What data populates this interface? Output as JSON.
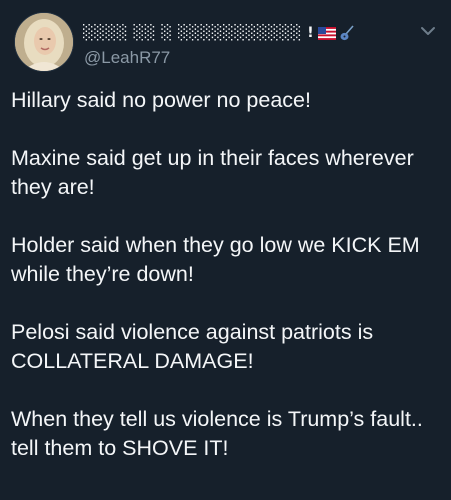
{
  "tweet": {
    "display_name": "░░░░ ░░ ░ ░░░░░░░░░░░ !",
    "handle": "@LeahR77",
    "badges": [
      "us-flag-icon",
      "guitar-icon"
    ],
    "paragraphs": [
      "Hillary said no power no peace!",
      "Maxine said get up in their faces wherever they are!",
      "Holder said when they go low we KICK EM while they’re down!",
      "Pelosi said violence against patriots is COLLATERAL DAMAGE!",
      "When they tell us violence is Trump’s fault.. tell them to SHOVE IT!"
    ]
  },
  "colors": {
    "background": "#16202b",
    "text": "#f4f6f8",
    "secondary_text": "#8b99a6"
  }
}
